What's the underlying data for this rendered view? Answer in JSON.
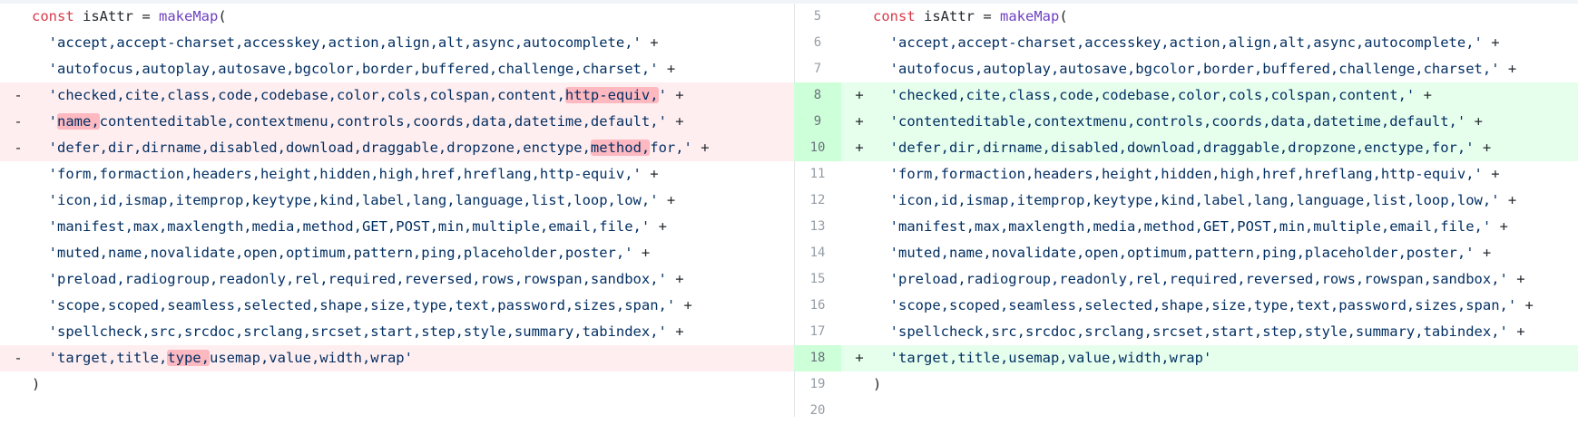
{
  "left": {
    "rows": [
      {
        "type": "context",
        "marker": "",
        "segments": [
          {
            "t": "const",
            "c": "kw"
          },
          {
            "t": " isAttr = "
          },
          {
            "t": "makeMap",
            "c": "fn"
          },
          {
            "t": "("
          }
        ]
      },
      {
        "type": "context",
        "marker": "",
        "segments": [
          {
            "t": "  'accept,accept-charset,accesskey,action,align,alt,async,autocomplete,'",
            "c": "str"
          },
          {
            "t": " +"
          }
        ]
      },
      {
        "type": "context",
        "marker": "",
        "segments": [
          {
            "t": "  'autofocus,autoplay,autosave,bgcolor,border,buffered,challenge,charset,'",
            "c": "str"
          },
          {
            "t": " +"
          }
        ]
      },
      {
        "type": "del",
        "marker": "-",
        "segments": [
          {
            "t": "  'checked,cite,class,code,codebase,color,cols,colspan,content,",
            "c": "str"
          },
          {
            "t": "http-equiv,",
            "c": "str hl"
          },
          {
            "t": "'",
            "c": "str"
          },
          {
            "t": " +"
          }
        ]
      },
      {
        "type": "del",
        "marker": "-",
        "segments": [
          {
            "t": "  '",
            "c": "str"
          },
          {
            "t": "name,",
            "c": "str hl"
          },
          {
            "t": "contenteditable,contextmenu,controls,coords,data,datetime,default,'",
            "c": "str"
          },
          {
            "t": " +"
          }
        ]
      },
      {
        "type": "del",
        "marker": "-",
        "segments": [
          {
            "t": "  'defer,dir,dirname,disabled,download,draggable,dropzone,enctype,",
            "c": "str"
          },
          {
            "t": "method,",
            "c": "str hl"
          },
          {
            "t": "for,'",
            "c": "str"
          },
          {
            "t": " +"
          }
        ]
      },
      {
        "type": "context",
        "marker": "",
        "segments": [
          {
            "t": "  'form,formaction,headers,height,hidden,high,href,hreflang,http-equiv,'",
            "c": "str"
          },
          {
            "t": " +"
          }
        ]
      },
      {
        "type": "context",
        "marker": "",
        "segments": [
          {
            "t": "  'icon,id,ismap,itemprop,keytype,kind,label,lang,language,list,loop,low,'",
            "c": "str"
          },
          {
            "t": " +"
          }
        ]
      },
      {
        "type": "context",
        "marker": "",
        "segments": [
          {
            "t": "  'manifest,max,maxlength,media,method,GET,POST,min,multiple,email,file,'",
            "c": "str"
          },
          {
            "t": " +"
          }
        ]
      },
      {
        "type": "context",
        "marker": "",
        "segments": [
          {
            "t": "  'muted,name,novalidate,open,optimum,pattern,ping,placeholder,poster,'",
            "c": "str"
          },
          {
            "t": " +"
          }
        ]
      },
      {
        "type": "context",
        "marker": "",
        "segments": [
          {
            "t": "  'preload,radiogroup,readonly,rel,required,reversed,rows,rowspan,sandbox,'",
            "c": "str"
          },
          {
            "t": " +"
          }
        ]
      },
      {
        "type": "context",
        "marker": "",
        "segments": [
          {
            "t": "  'scope,scoped,seamless,selected,shape,size,type,text,password,sizes,span,'",
            "c": "str"
          },
          {
            "t": " +"
          }
        ]
      },
      {
        "type": "context",
        "marker": "",
        "segments": [
          {
            "t": "  'spellcheck,src,srcdoc,srclang,srcset,start,step,style,summary,tabindex,'",
            "c": "str"
          },
          {
            "t": " +"
          }
        ]
      },
      {
        "type": "del",
        "marker": "-",
        "segments": [
          {
            "t": "  'target,title,",
            "c": "str"
          },
          {
            "t": "type,",
            "c": "str hl"
          },
          {
            "t": "usemap,value,width,wrap'",
            "c": "str"
          }
        ]
      },
      {
        "type": "context",
        "marker": "",
        "segments": [
          {
            "t": ")"
          }
        ]
      }
    ]
  },
  "right": {
    "rows": [
      {
        "type": "context",
        "num": "5",
        "marker": "",
        "segments": [
          {
            "t": "const",
            "c": "kw"
          },
          {
            "t": " isAttr = "
          },
          {
            "t": "makeMap",
            "c": "fn"
          },
          {
            "t": "("
          }
        ]
      },
      {
        "type": "context",
        "num": "6",
        "marker": "",
        "segments": [
          {
            "t": "  'accept,accept-charset,accesskey,action,align,alt,async,autocomplete,'",
            "c": "str"
          },
          {
            "t": " +"
          }
        ]
      },
      {
        "type": "context",
        "num": "7",
        "marker": "",
        "segments": [
          {
            "t": "  'autofocus,autoplay,autosave,bgcolor,border,buffered,challenge,charset,'",
            "c": "str"
          },
          {
            "t": " +"
          }
        ]
      },
      {
        "type": "add",
        "num": "8",
        "marker": "+",
        "segments": [
          {
            "t": "  'checked,cite,class,code,codebase,color,cols,colspan,content,'",
            "c": "str"
          },
          {
            "t": " +"
          }
        ]
      },
      {
        "type": "add",
        "num": "9",
        "marker": "+",
        "segments": [
          {
            "t": "  'contenteditable,contextmenu,controls,coords,data,datetime,default,'",
            "c": "str"
          },
          {
            "t": " +"
          }
        ]
      },
      {
        "type": "add",
        "num": "10",
        "marker": "+",
        "segments": [
          {
            "t": "  'defer,dir,dirname,disabled,download,draggable,dropzone,enctype,for,'",
            "c": "str"
          },
          {
            "t": " +"
          }
        ]
      },
      {
        "type": "context",
        "num": "11",
        "marker": "",
        "segments": [
          {
            "t": "  'form,formaction,headers,height,hidden,high,href,hreflang,http-equiv,'",
            "c": "str"
          },
          {
            "t": " +"
          }
        ]
      },
      {
        "type": "context",
        "num": "12",
        "marker": "",
        "segments": [
          {
            "t": "  'icon,id,ismap,itemprop,keytype,kind,label,lang,language,list,loop,low,'",
            "c": "str"
          },
          {
            "t": " +"
          }
        ]
      },
      {
        "type": "context",
        "num": "13",
        "marker": "",
        "segments": [
          {
            "t": "  'manifest,max,maxlength,media,method,GET,POST,min,multiple,email,file,'",
            "c": "str"
          },
          {
            "t": " +"
          }
        ]
      },
      {
        "type": "context",
        "num": "14",
        "marker": "",
        "segments": [
          {
            "t": "  'muted,name,novalidate,open,optimum,pattern,ping,placeholder,poster,'",
            "c": "str"
          },
          {
            "t": " +"
          }
        ]
      },
      {
        "type": "context",
        "num": "15",
        "marker": "",
        "segments": [
          {
            "t": "  'preload,radiogroup,readonly,rel,required,reversed,rows,rowspan,sandbox,'",
            "c": "str"
          },
          {
            "t": " +"
          }
        ]
      },
      {
        "type": "context",
        "num": "16",
        "marker": "",
        "segments": [
          {
            "t": "  'scope,scoped,seamless,selected,shape,size,type,text,password,sizes,span,'",
            "c": "str"
          },
          {
            "t": " +"
          }
        ]
      },
      {
        "type": "context",
        "num": "17",
        "marker": "",
        "segments": [
          {
            "t": "  'spellcheck,src,srcdoc,srclang,srcset,start,step,style,summary,tabindex,'",
            "c": "str"
          },
          {
            "t": " +"
          }
        ]
      },
      {
        "type": "add",
        "num": "18",
        "marker": "+",
        "segments": [
          {
            "t": "  'target,title,usemap,value,width,wrap'",
            "c": "str"
          }
        ]
      },
      {
        "type": "context",
        "num": "19",
        "marker": "",
        "segments": [
          {
            "t": ")"
          }
        ]
      },
      {
        "type": "context",
        "num": "20",
        "marker": "",
        "segments": []
      }
    ]
  }
}
